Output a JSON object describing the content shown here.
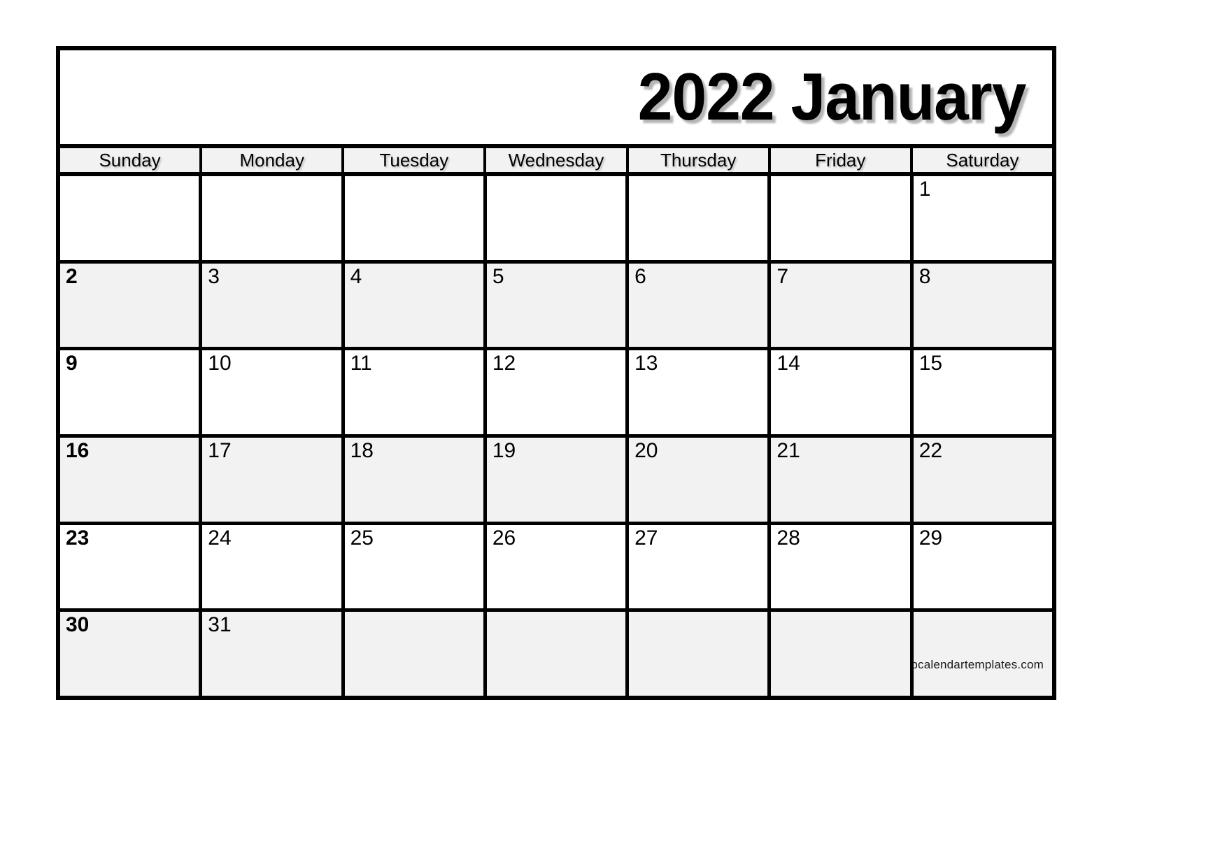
{
  "calendar": {
    "title": "2022 January",
    "year": "2022",
    "month": "January",
    "weekday_headers": [
      "Sunday",
      "Monday",
      "Tuesday",
      "Wednesday",
      "Thursday",
      "Friday",
      "Saturday"
    ],
    "weeks": [
      [
        "",
        "",
        "",
        "",
        "",
        "",
        "1"
      ],
      [
        "2",
        "3",
        "4",
        "5",
        "6",
        "7",
        "8"
      ],
      [
        "9",
        "10",
        "11",
        "12",
        "13",
        "14",
        "15"
      ],
      [
        "16",
        "17",
        "18",
        "19",
        "20",
        "21",
        "22"
      ],
      [
        "23",
        "24",
        "25",
        "26",
        "27",
        "28",
        "29"
      ],
      [
        "30",
        "31",
        "",
        "",
        "",
        "",
        ""
      ]
    ],
    "shaded_weeks": [
      1,
      3,
      5
    ],
    "credit": "topcalendartemplates.com",
    "colors": {
      "border": "#000000",
      "shaded_cell": "#f2f2f2",
      "plain_cell": "#ffffff",
      "header_background": "#f2f2f2",
      "text": "#000000",
      "page_background": "#ffffff"
    }
  }
}
